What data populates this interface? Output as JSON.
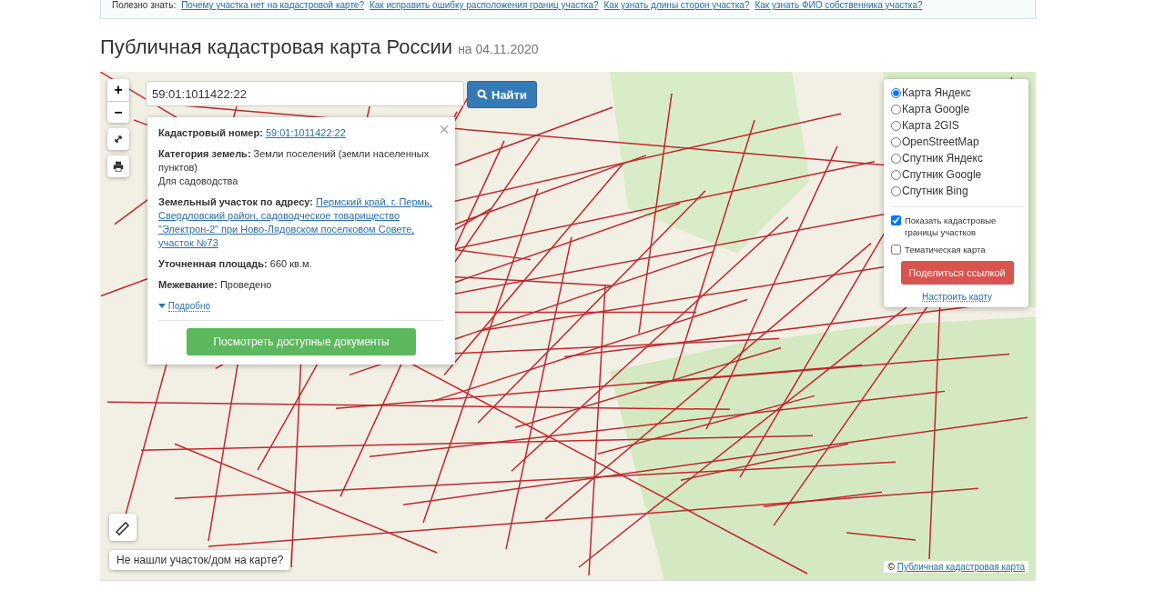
{
  "useful": {
    "label": "Полезно знать:",
    "links": [
      "Почему участка нет на кадастровой карте?",
      "Как исправить ошибку расположения границ участка?",
      "Как узнать длины сторон участка?",
      "Как узнать ФИО собственника участка?"
    ]
  },
  "heading": {
    "title": "Публичная кадастровая карта России",
    "date": "на 04.11.2020"
  },
  "search": {
    "value": "59:01:1011422:22",
    "button": "Найти"
  },
  "zoom": {
    "plus": "+",
    "minus": "−"
  },
  "popup": {
    "close": "×",
    "fields": [
      {
        "label": "Кадастровый номер:",
        "value": "59:01:1011422:22",
        "kind": "link"
      },
      {
        "label": "Категория земель:",
        "value": "Земли поселений (земли населенных пунктов)",
        "extra": "Для садоводства",
        "kind": "text"
      },
      {
        "label": "Земельный участок по адресу:",
        "value": "Пермский край, г. Пермь, Свердловский район, садоводческое товарищество \"Электрон-2\" при Ново-Лядовском поселковом Совете, участок №73",
        "kind": "link"
      },
      {
        "label": "Уточненная площадь:",
        "value": "660 кв.м.",
        "kind": "text"
      },
      {
        "label": "Межевание:",
        "value": "Проведено",
        "kind": "text"
      }
    ],
    "more": "Подробно",
    "docs_button": "Посмотреть доступные документы"
  },
  "layers": {
    "maps": [
      {
        "label": "Карта Яндекс",
        "selected": true
      },
      {
        "label": "Карта Google",
        "selected": false
      },
      {
        "label": "Карта 2GIS",
        "selected": false
      },
      {
        "label": "OpenStreetMap",
        "selected": false
      },
      {
        "label": "Спутник Яндекс",
        "selected": false
      },
      {
        "label": "Спутник Google",
        "selected": false
      },
      {
        "label": "Спутник Bing",
        "selected": false
      }
    ],
    "options": [
      {
        "label": "Показать кадастровые границы участков",
        "checked": true
      },
      {
        "label": "Тематическая карта",
        "checked": false
      }
    ],
    "share": "Поделиться ссылкой",
    "configure": "Настроить карту"
  },
  "not_found": "Не нашли участок/дом на карте?",
  "attribution": {
    "mark": "©",
    "link": "Публичная кадастровая карта"
  }
}
